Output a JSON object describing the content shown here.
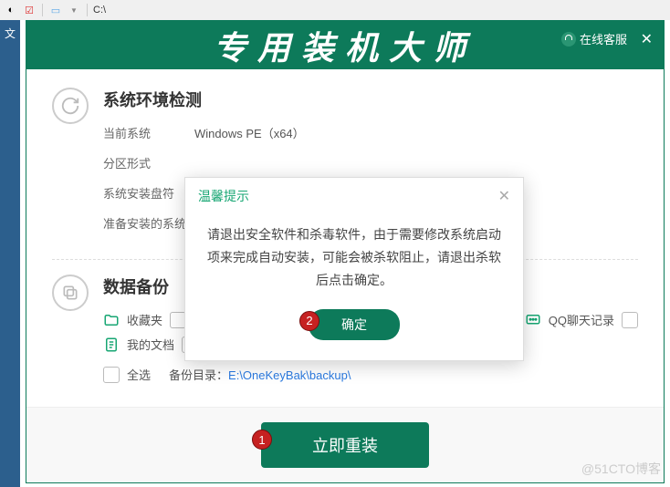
{
  "toolbar": {
    "path": "C:\\"
  },
  "leftStrip": "文",
  "header": {
    "title": "专用装机大师",
    "onlineCs": "在线客服"
  },
  "env": {
    "sectionTitle": "系统环境检测",
    "rows": {
      "currentSystemLabel": "当前系统",
      "currentSystemValue": "Windows PE（x64）",
      "partitionLabel": "分区形式",
      "installDriveLabel": "系统安装盘符",
      "targetSystemLabel": "准备安装的系统"
    }
  },
  "backup": {
    "sectionTitle": "数据备份",
    "items": {
      "favorites": "收藏夹",
      "myDocs": "我的文档",
      "qq": "QQ聊天记录",
      "selectAll": "全选"
    },
    "pathLabel": "备份目录：",
    "pathValue": "E:\\OneKeyBak\\backup\\"
  },
  "footer": {
    "reinstall": "立即重装",
    "badge1": "1"
  },
  "dialog": {
    "title": "温馨提示",
    "body": "请退出安全软件和杀毒软件，由于需要修改系统启动项来完成自动安装，可能会被杀软阻止，请退出杀软后点击确定。",
    "ok": "确定",
    "badge2": "2"
  },
  "watermark": "@51CTO博客"
}
